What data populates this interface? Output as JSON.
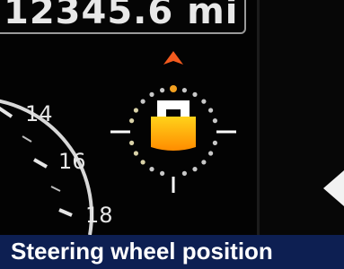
{
  "odometer": {
    "reading": "12345.6 mi"
  },
  "speedometer": {
    "tick_labels": [
      "14",
      "16",
      "18"
    ]
  },
  "steering_indicator": {
    "direction_marker": "arrow-up-icon",
    "colors": {
      "arrow": "#f25a1e",
      "bar_top": "#ffd21a",
      "bar_bottom": "#ff8c00",
      "dots": "#c8c8c8",
      "highlight_dot": "#f2a020"
    }
  },
  "caption": {
    "text": "Steering wheel position"
  },
  "colors": {
    "caption_bar": "#0d1f52",
    "background": "#030303"
  }
}
